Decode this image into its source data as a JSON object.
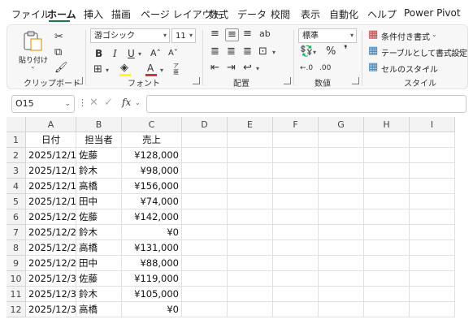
{
  "ribbon_tabs": [
    "ファイル",
    "ホーム",
    "挿入",
    "描画",
    "ページ レイアウト",
    "数式",
    "データ",
    "校閲",
    "表示",
    "自動化",
    "ヘルプ",
    "Power Pivot"
  ],
  "active_tab": "ホーム",
  "clipboard": {
    "paste_label": "貼り付け",
    "group_label": "クリップボード"
  },
  "font": {
    "name": "游ゴシック",
    "size": "11",
    "group_label": "フォント",
    "bold": "B",
    "italic": "I",
    "underline": "U",
    "grow": "A˄",
    "shrink": "A˅",
    "color_letter": "A",
    "phonetic": "ア亜"
  },
  "alignment": {
    "group_label": "配置"
  },
  "number": {
    "format": "標準",
    "percent": "%",
    "comma": "❜",
    "group_label": "数値"
  },
  "styles": {
    "conditional": "条件付き書式",
    "table": "テーブルとして書式設定",
    "cell": "セルのスタイル",
    "group_label": "スタイル"
  },
  "formula_bar": {
    "name_box": "O15",
    "fx": "fx",
    "content": ""
  },
  "columns": [
    "A",
    "B",
    "C",
    "D",
    "E",
    "F",
    "G",
    "H",
    "I"
  ],
  "rows": [
    {
      "num": "1",
      "a": "日付",
      "b": "担当者",
      "c": "売上"
    },
    {
      "num": "2",
      "a": "2025/12/1",
      "b": "佐藤",
      "c": "¥128,000"
    },
    {
      "num": "3",
      "a": "2025/12/1",
      "b": "鈴木",
      "c": "¥98,000"
    },
    {
      "num": "4",
      "a": "2025/12/1",
      "b": "高橋",
      "c": "¥156,000"
    },
    {
      "num": "5",
      "a": "2025/12/1",
      "b": "田中",
      "c": "¥74,000"
    },
    {
      "num": "6",
      "a": "2025/12/2",
      "b": "佐藤",
      "c": "¥142,000"
    },
    {
      "num": "7",
      "a": "2025/12/2",
      "b": "鈴木",
      "c": "¥0"
    },
    {
      "num": "8",
      "a": "2025/12/2",
      "b": "高橋",
      "c": "¥131,000"
    },
    {
      "num": "9",
      "a": "2025/12/2",
      "b": "田中",
      "c": "¥88,000"
    },
    {
      "num": "10",
      "a": "2025/12/3",
      "b": "佐藤",
      "c": "¥119,000"
    },
    {
      "num": "11",
      "a": "2025/12/3",
      "b": "鈴木",
      "c": "¥105,000"
    },
    {
      "num": "12",
      "a": "2025/12/3",
      "b": "高橋",
      "c": "¥0"
    }
  ],
  "colors": {
    "accent": "#107c41",
    "font_color_bar": "#d13438",
    "highlight_bar": "#ffff00"
  }
}
